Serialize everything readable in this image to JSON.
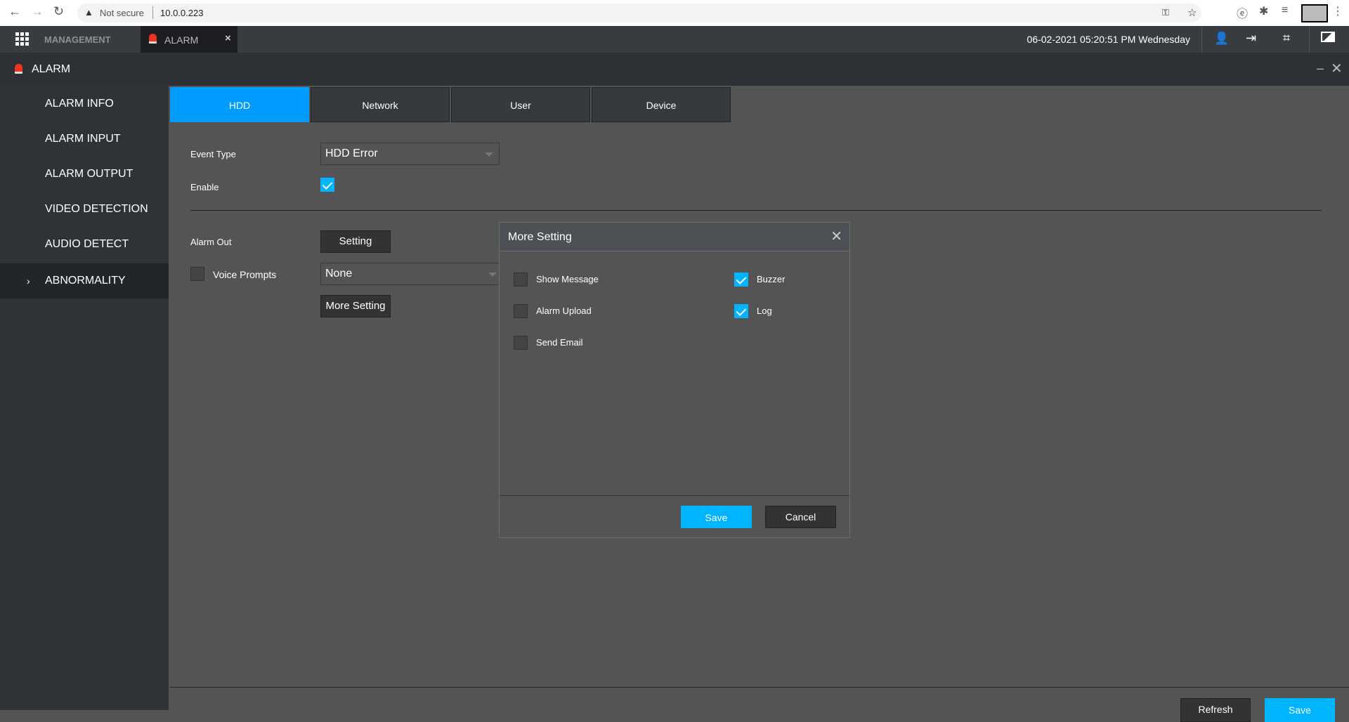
{
  "browser": {
    "security": "Not secure",
    "url": "10.0.0.223"
  },
  "topbar": {
    "management": "MANAGEMENT",
    "tab": "ALARM",
    "datetime": "06-02-2021 05:20:51 PM Wednesday"
  },
  "header": {
    "title": "ALARM"
  },
  "sidebar": {
    "items": [
      {
        "label": "ALARM INFO"
      },
      {
        "label": "ALARM INPUT"
      },
      {
        "label": "ALARM OUTPUT"
      },
      {
        "label": "VIDEO DETECTION"
      },
      {
        "label": "AUDIO DETECT"
      },
      {
        "label": "ABNORMALITY",
        "active": true
      }
    ]
  },
  "tabs": [
    {
      "label": "HDD",
      "active": true
    },
    {
      "label": "Network"
    },
    {
      "label": "User"
    },
    {
      "label": "Device"
    }
  ],
  "form": {
    "event_type_label": "Event Type",
    "event_type_value": "HDD Error",
    "enable_label": "Enable",
    "enable_checked": true,
    "alarm_out_label": "Alarm Out",
    "setting_button": "Setting",
    "voice_prompts_label": "Voice Prompts",
    "voice_prompts_checked": false,
    "voice_value": "None",
    "more_setting_button": "More Setting"
  },
  "dialog": {
    "title": "More Setting",
    "options": [
      {
        "label": "Show Message",
        "checked": false
      },
      {
        "label": "Buzzer",
        "checked": true
      },
      {
        "label": "Alarm Upload",
        "checked": false
      },
      {
        "label": "Log",
        "checked": true
      },
      {
        "label": "Send Email",
        "checked": false
      }
    ],
    "save": "Save",
    "cancel": "Cancel"
  },
  "footer": {
    "refresh": "Refresh",
    "save": "Save"
  },
  "colors": {
    "accent": "#009cff",
    "checkbox": "#00b4ff"
  }
}
